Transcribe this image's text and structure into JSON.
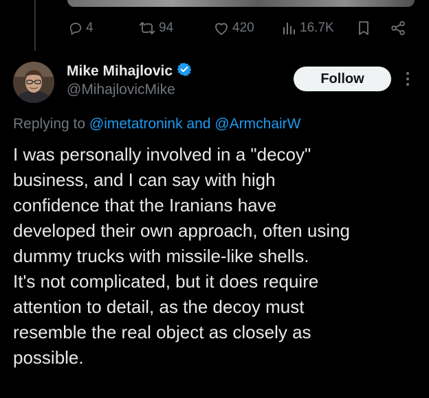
{
  "actions": {
    "reply_count": "4",
    "retweet_count": "94",
    "like_count": "420",
    "view_count": "16.7K"
  },
  "author": {
    "name": "Mike Mihajlovic",
    "handle": "@MihajlovicMike",
    "verified": true
  },
  "follow_label": "Follow",
  "replying": {
    "prefix": "Replying to",
    "user1": "@imetatronink",
    "conjunction": "and",
    "user2": "@ArmchairW"
  },
  "tweet_lines": [
    "I was personally involved in a \"decoy\"",
    "business, and I can say with high",
    "confidence that the Iranians have",
    "developed their own approach, often using",
    "dummy trucks with missile-like shells.",
    "It's not complicated, but it does require",
    "attention to detail, as the decoy must",
    "resemble the real object as closely as",
    "possible."
  ],
  "icons": {
    "reply": "reply-icon",
    "retweet": "retweet-icon",
    "like": "heart-icon",
    "views": "views-icon",
    "bookmark": "bookmark-icon",
    "share": "share-icon",
    "verified": "verified-badge-icon",
    "more": "more-icon"
  },
  "colors": {
    "background": "#000000",
    "text": "#e7e9ea",
    "muted": "#71767b",
    "accent": "#1d9bf0",
    "follow_bg": "#eff3f4"
  }
}
